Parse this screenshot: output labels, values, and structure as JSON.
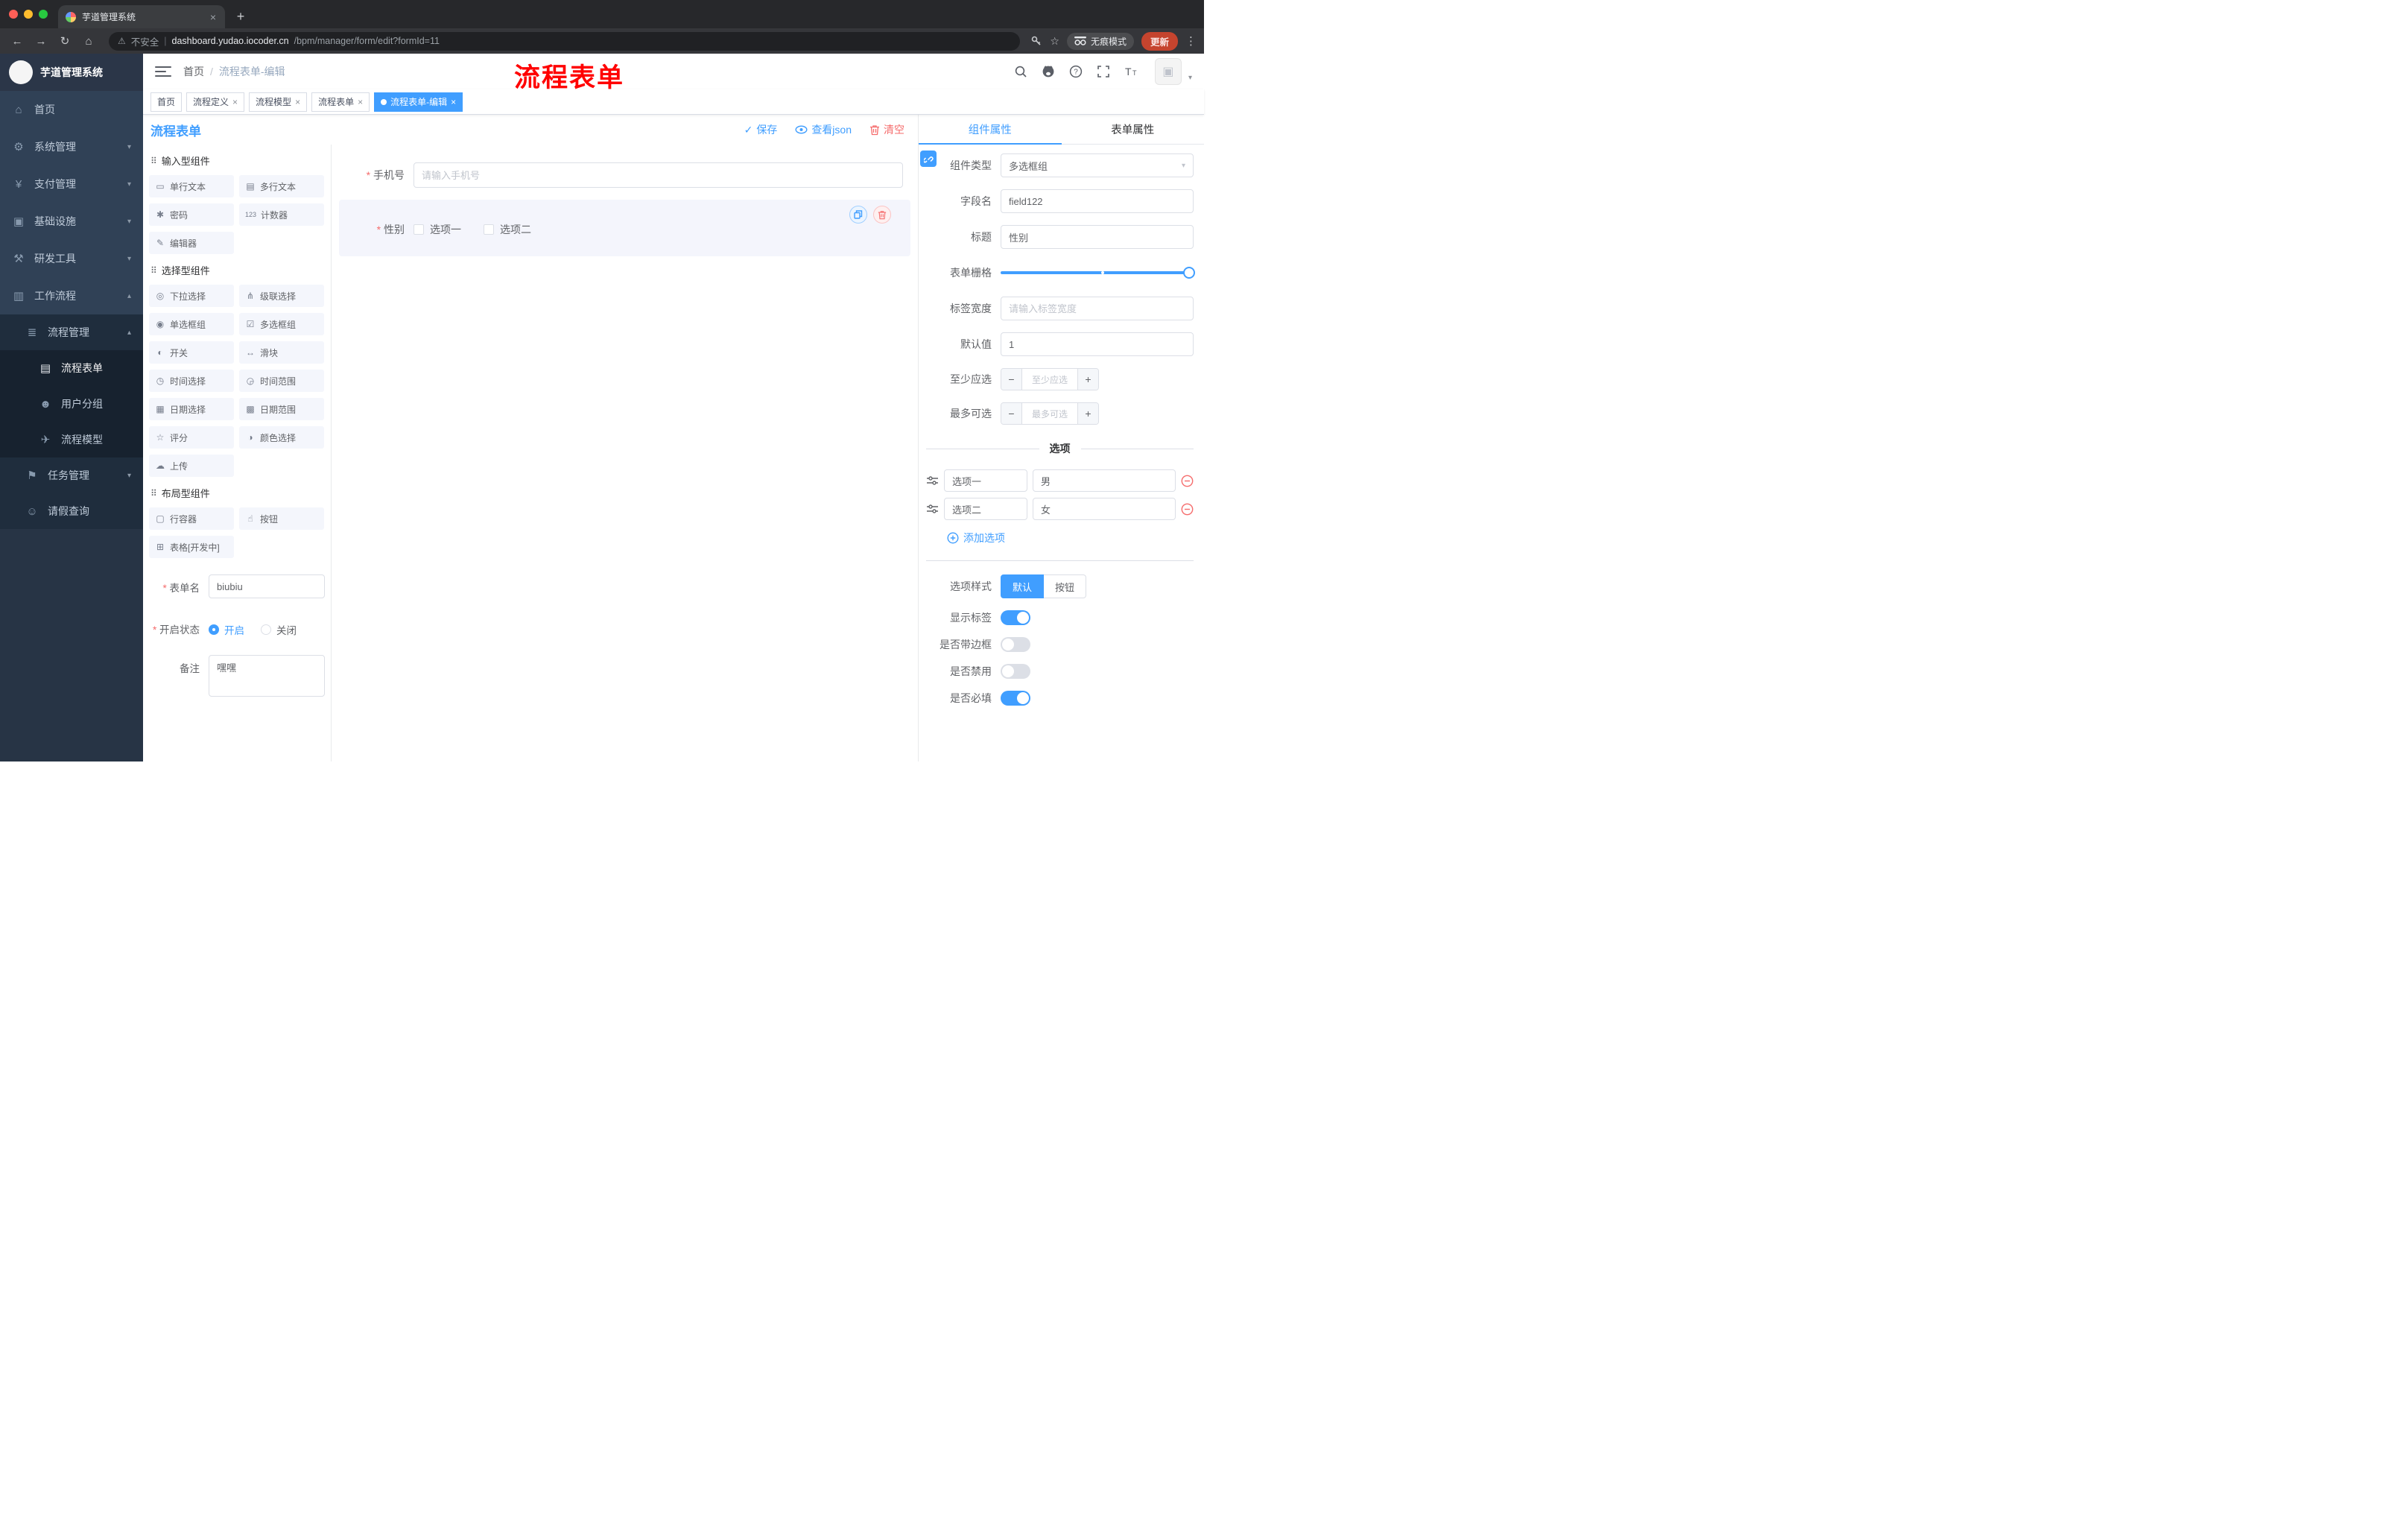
{
  "colors": {
    "accent": "#409eff",
    "danger": "#f56c6c",
    "annotation": "#ff0000",
    "tag_active": "#409eff"
  },
  "browser": {
    "tab_title": "芋道管理系统",
    "new_tab": "+",
    "url": {
      "security": "不安全",
      "domain": "dashboard.yudao.iocoder.cn",
      "path": "/bpm/manager/form/edit?formId=11"
    },
    "incognito_label": "无痕模式",
    "update_label": "更新"
  },
  "sidebar": {
    "logo_title": "芋道管理系统",
    "items": [
      {
        "icon": "⌂",
        "label": "首页"
      },
      {
        "icon": "⚙",
        "label": "系统管理",
        "chevron": "▾"
      },
      {
        "icon": "¥",
        "label": "支付管理",
        "chevron": "▾"
      },
      {
        "icon": "▣",
        "label": "基础设施",
        "chevron": "▾"
      },
      {
        "icon": "⚒",
        "label": "研发工具",
        "chevron": "▾"
      },
      {
        "icon": "▥",
        "label": "工作流程",
        "chevron": "▴"
      },
      {
        "icon": "≣",
        "label": "流程管理",
        "chevron": "▴"
      },
      {
        "icon": "▤",
        "label": "流程表单"
      },
      {
        "icon": "☻",
        "label": "用户分组"
      },
      {
        "icon": "✈",
        "label": "流程模型"
      },
      {
        "icon": "⚑",
        "label": "任务管理",
        "chevron": "▾"
      },
      {
        "icon": "☺",
        "label": "请假查询"
      }
    ]
  },
  "header": {
    "breadcrumb_home": "首页",
    "breadcrumb_separator": "/",
    "breadcrumb_current": "流程表单-编辑",
    "annotation": "流程表单"
  },
  "tags": [
    {
      "label": "首页"
    },
    {
      "label": "流程定义"
    },
    {
      "label": "流程模型"
    },
    {
      "label": "流程表单"
    },
    {
      "label": "流程表单-编辑"
    }
  ],
  "designer": {
    "title": "流程表单",
    "save_label": "保存",
    "view_json_label": "查看json",
    "clear_label": "清空",
    "palette": {
      "groups": [
        {
          "title": "输入型组件",
          "items": [
            {
              "icon": "▭",
              "label": "单行文本"
            },
            {
              "icon": "▤",
              "label": "多行文本"
            },
            {
              "icon": "✱",
              "label": "密码"
            },
            {
              "icon": "123",
              "label": "计数器"
            },
            {
              "icon": "✎",
              "label": "编辑器"
            }
          ]
        },
        {
          "title": "选择型组件",
          "items": [
            {
              "icon": "◎",
              "label": "下拉选择"
            },
            {
              "icon": "⋔",
              "label": "级联选择"
            },
            {
              "icon": "◉",
              "label": "单选框组"
            },
            {
              "icon": "☑",
              "label": "多选框组"
            },
            {
              "icon": "◐",
              "label": "开关"
            },
            {
              "icon": "↔",
              "label": "滑块"
            },
            {
              "icon": "◷",
              "label": "时间选择"
            },
            {
              "icon": "◶",
              "label": "时间范围"
            },
            {
              "icon": "▦",
              "label": "日期选择"
            },
            {
              "icon": "▩",
              "label": "日期范围"
            },
            {
              "icon": "☆",
              "label": "评分"
            },
            {
              "icon": "◑",
              "label": "颜色选择"
            },
            {
              "icon": "☁",
              "label": "上传"
            }
          ]
        },
        {
          "title": "布局型组件",
          "items": [
            {
              "icon": "▢",
              "label": "行容器"
            },
            {
              "icon": "☝",
              "label": "按钮"
            },
            {
              "icon": "⊞",
              "label": "表格[开发中]"
            }
          ]
        }
      ]
    },
    "meta": {
      "name_label": "表单名",
      "name_value": "biubiu",
      "status_label": "开启状态",
      "status_on": "开启",
      "status_off": "关闭",
      "remark_label": "备注",
      "remark_value": "嘿嘿"
    },
    "canvas": {
      "phone_label": "手机号",
      "phone_placeholder": "请输入手机号",
      "gender_label": "性别",
      "gender_opt1": "选项一",
      "gender_opt2": "选项二"
    }
  },
  "props": {
    "tab_component": "组件属性",
    "tab_form": "表单属性",
    "component_type_label": "组件类型",
    "component_type_value": "多选框组",
    "field_name_label": "字段名",
    "field_name_value": "field122",
    "title_label": "标题",
    "title_value": "性别",
    "grid_label": "表单栅格",
    "label_width_label": "标签宽度",
    "label_width_placeholder": "请输入标签宽度",
    "default_label": "默认值",
    "default_value": "1",
    "min_label": "至少应选",
    "min_placeholder": "至少应选",
    "max_label": "最多可选",
    "max_placeholder": "最多可选",
    "options_title": "选项",
    "option1_label": "选项一",
    "option1_value": "男",
    "option2_label": "选项二",
    "option2_value": "女",
    "add_option_label": "添加选项",
    "style_label": "选项样式",
    "style_default": "默认",
    "style_button": "按钮",
    "switch_show_label": "显示标签",
    "switch_border": "是否带边框",
    "switch_disabled": "是否禁用",
    "switch_required": "是否必填"
  }
}
